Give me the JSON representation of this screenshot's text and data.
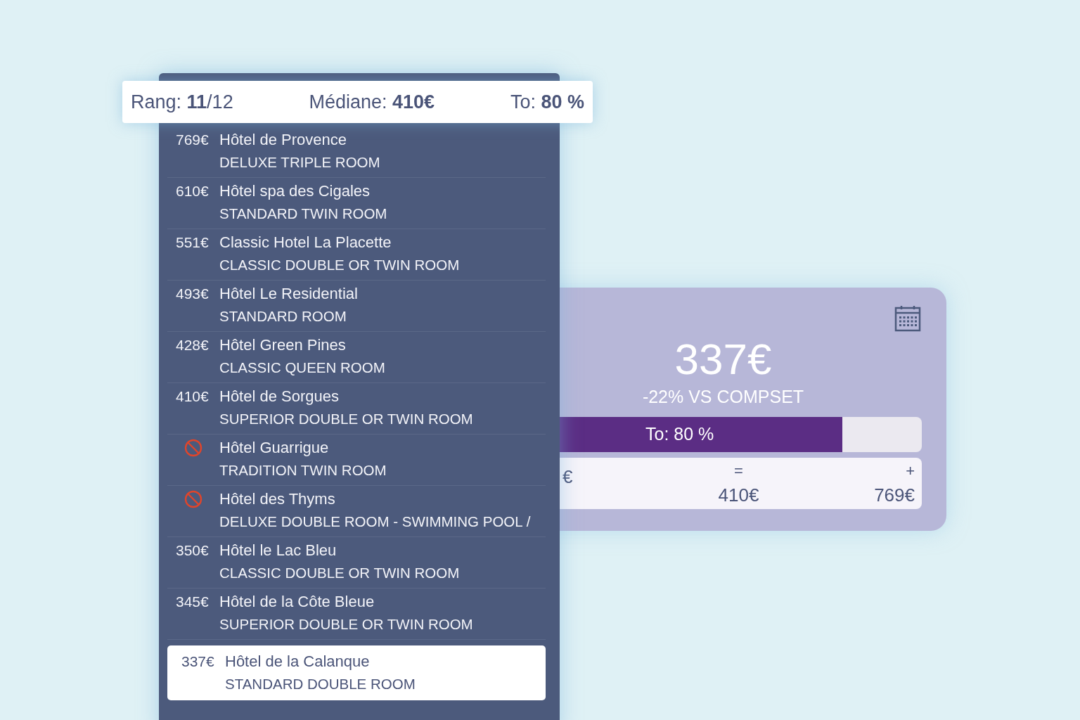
{
  "summary_bar": {
    "rank": "Rang: **11**/12",
    "median": "Médiane: **410€**",
    "occupancy": "To: **80 %**"
  },
  "hotels": [
    {
      "kind": "priced",
      "price": "769€",
      "name": "Hôtel de Provence",
      "room": "DELUXE TRIPLE ROOM",
      "selected": false
    },
    {
      "kind": "priced",
      "price": "610€",
      "name": "Hôtel spa des Cigales",
      "room": "STANDARD TWIN ROOM",
      "selected": false
    },
    {
      "kind": "priced",
      "price": "551€",
      "name": "Classic Hotel La Placette",
      "room": "CLASSIC DOUBLE OR TWIN ROOM",
      "selected": false
    },
    {
      "kind": "priced",
      "price": "493€",
      "name": "Hôtel Le Residential",
      "room": "STANDARD ROOM",
      "selected": false
    },
    {
      "kind": "priced",
      "price": "428€",
      "name": "Hôtel Green Pines",
      "room": "CLASSIC QUEEN ROOM",
      "selected": false
    },
    {
      "kind": "priced",
      "price": "410€",
      "name": "Hôtel de Sorgues",
      "room": "SUPERIOR DOUBLE OR TWIN ROOM",
      "selected": false
    },
    {
      "kind": "blocked",
      "name": "Hôtel Guarrigue",
      "room": "TRADITION TWIN ROOM",
      "selected": false
    },
    {
      "kind": "blocked",
      "name": "Hôtel des Thyms",
      "room": "DELUXE DOUBLE ROOM - SWIMMING POOL /",
      "selected": false
    },
    {
      "kind": "priced",
      "price": "350€",
      "name": "Hôtel le Lac Bleu",
      "room": "CLASSIC DOUBLE OR TWIN ROOM",
      "selected": false
    },
    {
      "kind": "priced",
      "price": "345€",
      "name": "Hôtel de la Côte Bleue",
      "room": "SUPERIOR DOUBLE OR TWIN ROOM",
      "selected": false
    },
    {
      "kind": "priced",
      "price": "337€",
      "name": "Hôtel de la Calanque",
      "room": "STANDARD DOUBLE ROOM",
      "selected": true
    }
  ],
  "price_card": {
    "price": "337€",
    "comparison": "-22% VS COMPSET",
    "occupancy": {
      "label": "To: 80 %",
      "level": 0.8
    },
    "range": [
      {
        "symbol": "=",
        "value": "410€"
      },
      {
        "symbol": "+",
        "value": "769€"
      }
    ],
    "range_low_value": "€"
  }
}
